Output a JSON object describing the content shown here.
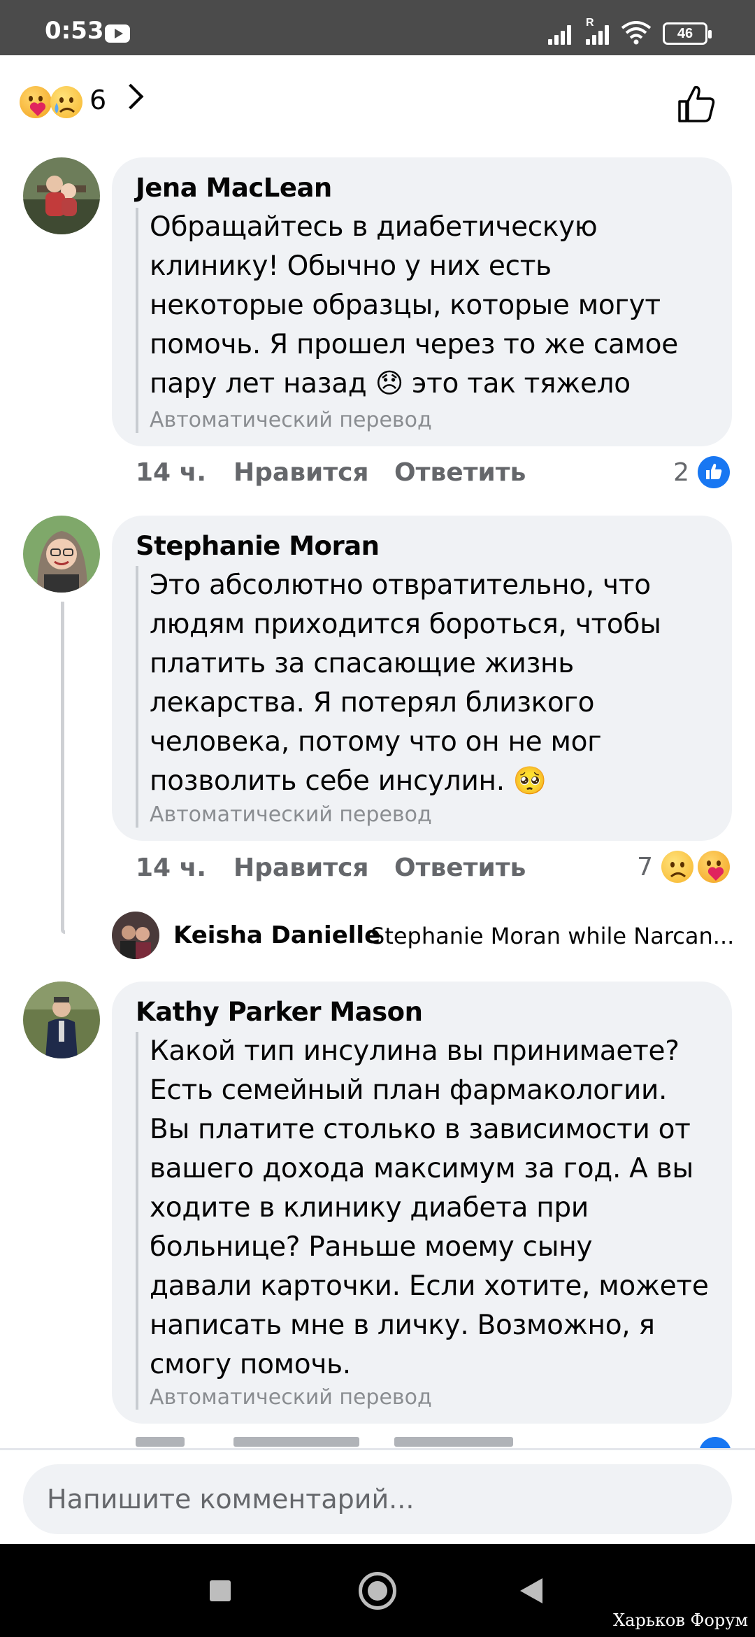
{
  "status_bar": {
    "time": "0:53",
    "battery": "46"
  },
  "reactions_header": {
    "count": "6",
    "icons": [
      "hug-emoji",
      "sad-tear-emoji"
    ]
  },
  "comments": [
    {
      "author": "Jena MacLean",
      "text": "Обращайтесь в диабетическую\nклинику! Обычно у них есть\nнекоторые образцы, которые могут\nпомочь. Я прошел через то же самое\nпару лет назад 😞 это так тяжело",
      "translated_label": "Автоматический перевод",
      "time": "14 ч.",
      "like_label": "Нравится",
      "reply_label": "Ответить",
      "reaction_count": "2"
    },
    {
      "author": "Stephanie Moran",
      "text": "Это абсолютно отвратительно, что\nлюдям приходится бороться, чтобы\nплатить за спасающие жизнь\nлекарства. Я потерял близкого\nчеловека, потому что он не мог\nпозволить себе инсулин. 🥺",
      "translated_label": "Автоматический перевод",
      "time": "14 ч.",
      "like_label": "Нравится",
      "reply_label": "Ответить",
      "reaction_count": "7"
    },
    {
      "author": "Kathy Parker Mason",
      "text": "Какой тип инсулина вы принимаете?\nЕсть семейный план фармакологии.\nВы платите столько в зависимости от\nвашего дохода максимум за год. А вы\nходите в клинику диабета при\nбольнице? Раньше моему сыну\nдавали карточки. Если хотите, можете\nнаписать мне в личку. Возможно, я\nсмогу помочь.",
      "translated_label": "Автоматический перевод"
    }
  ],
  "reply_preview": {
    "author": "Keisha Danielle",
    "text": "Stephanie Moran while Narcan..."
  },
  "composer": {
    "placeholder": "Напишите комментарий..."
  },
  "watermark": "Харьков Форум",
  "colors": {
    "bubble": "#f0f2f5",
    "meta": "#65676b",
    "facebook_blue": "#1877f2",
    "status_bar": "#4b4b4b"
  }
}
